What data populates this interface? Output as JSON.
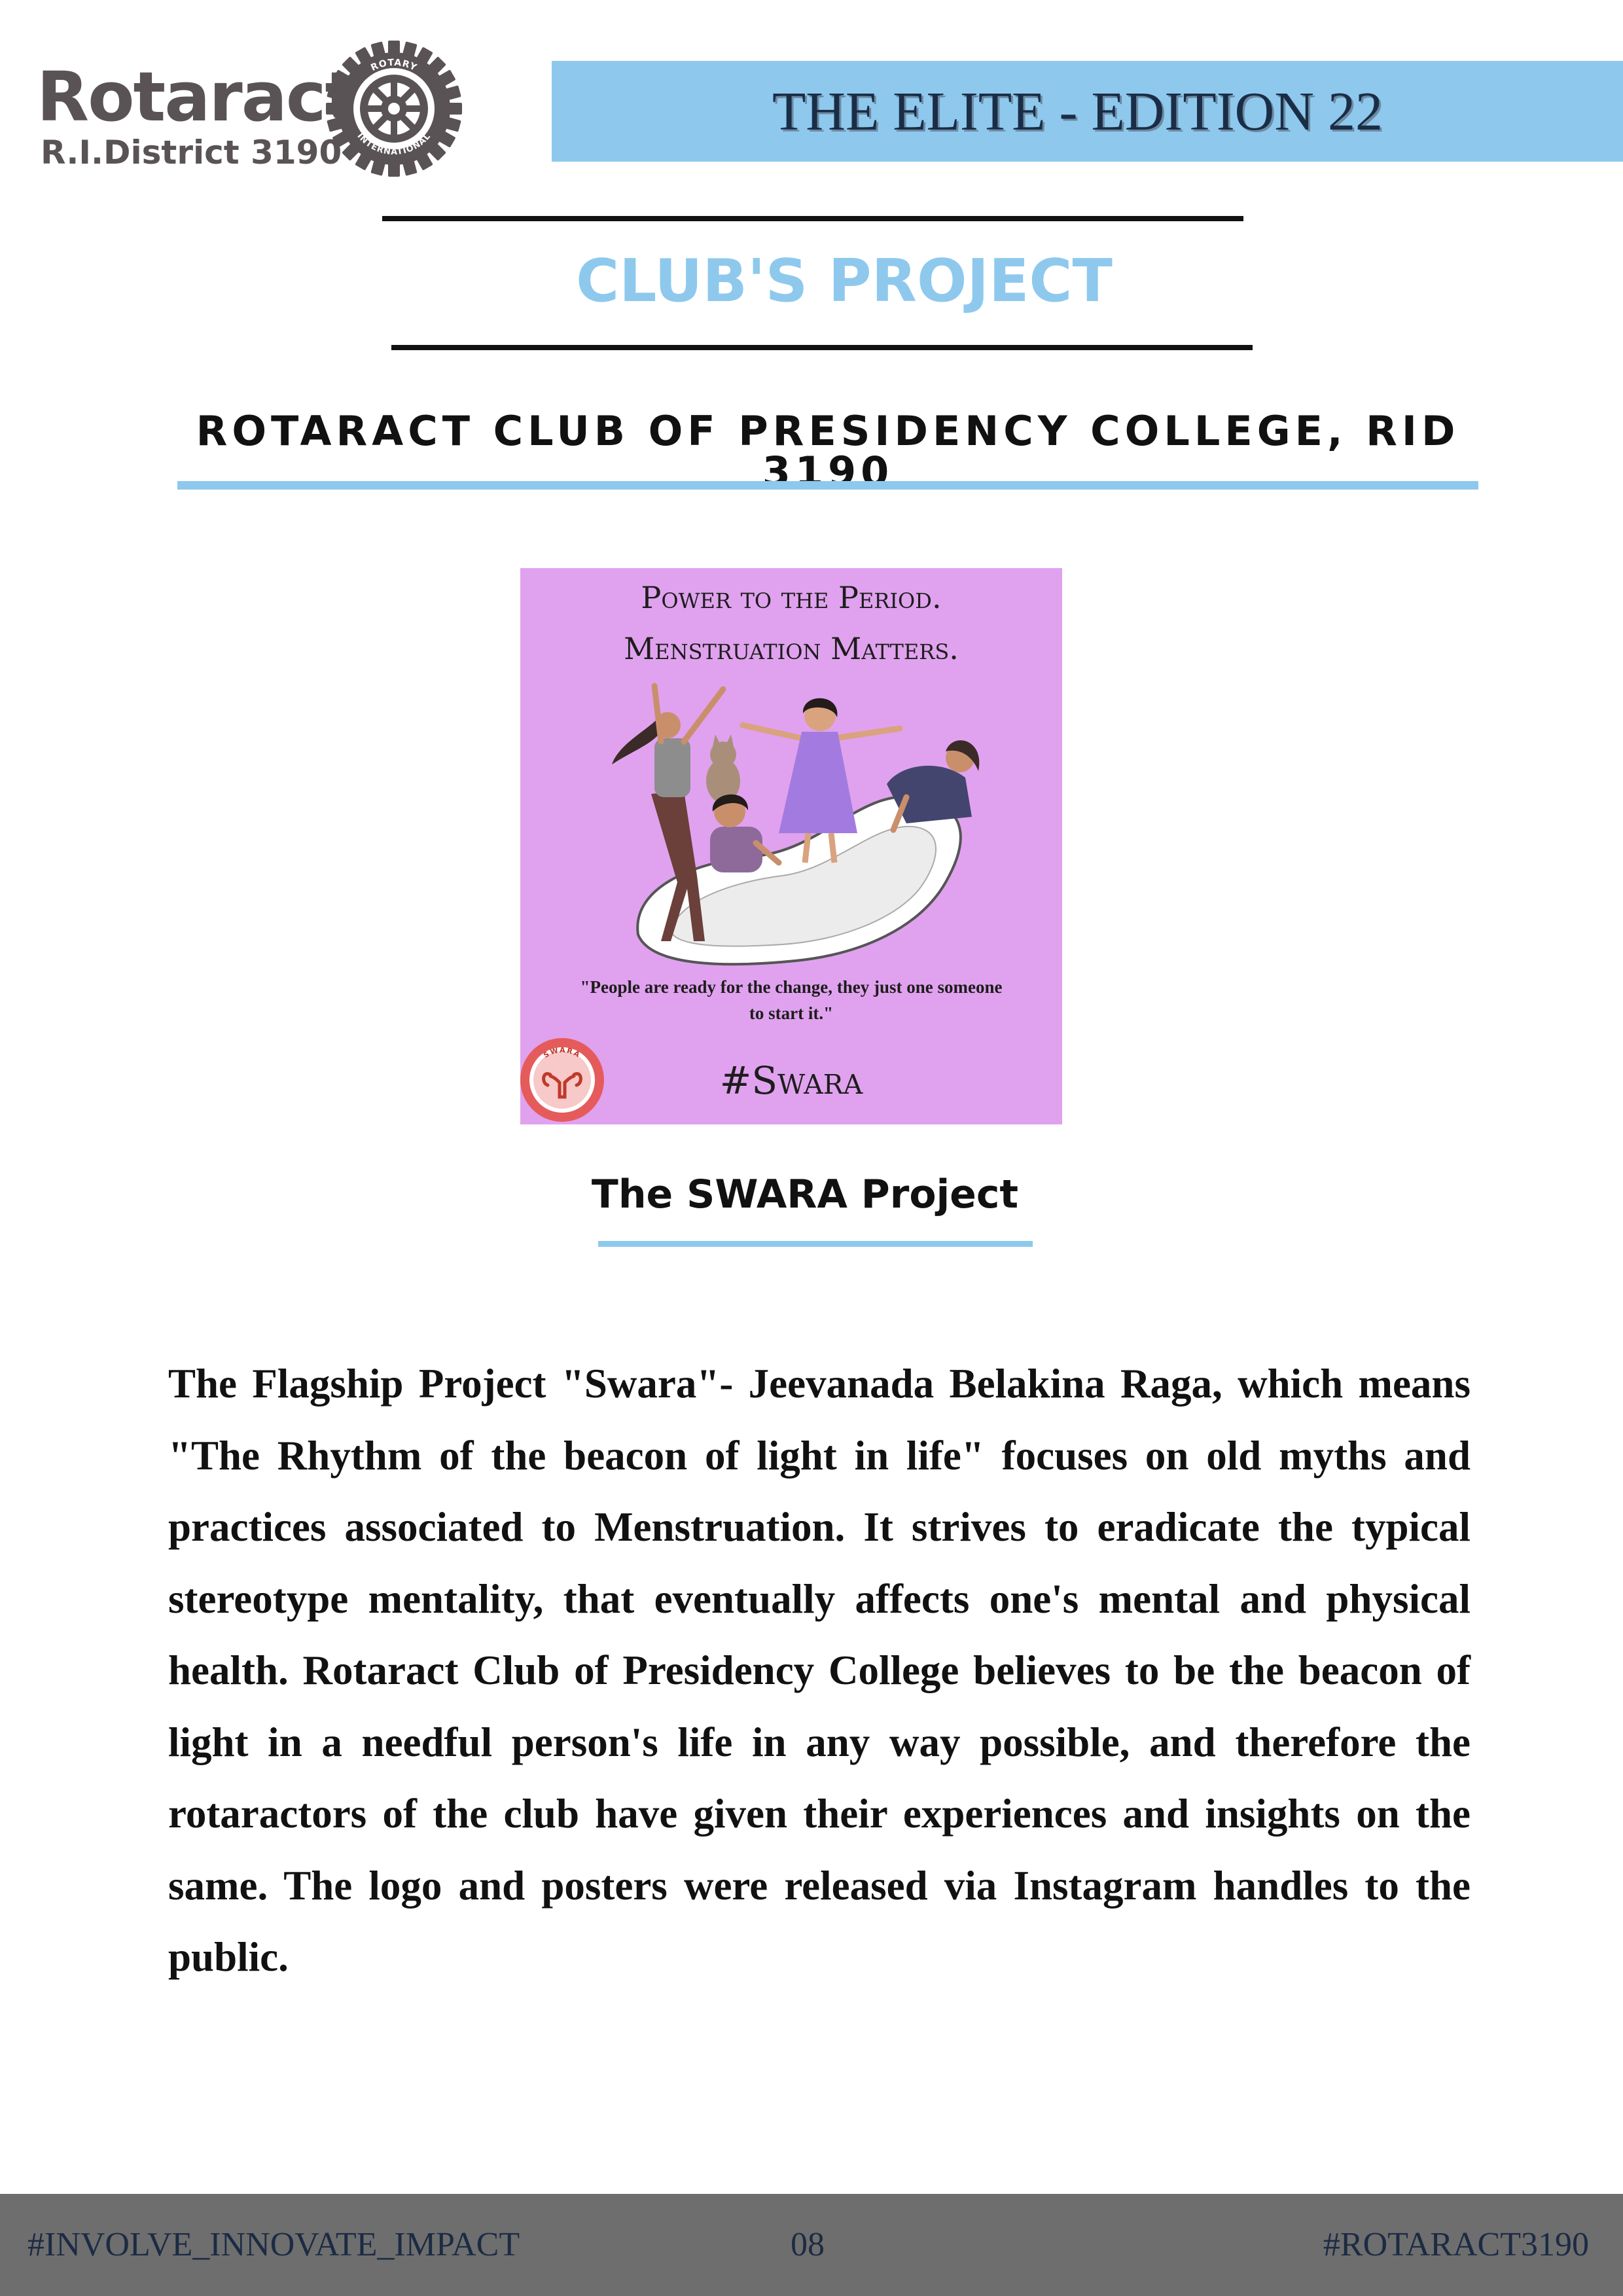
{
  "logo": {
    "wordmark": "Rotaract",
    "district": "R.I.District 3190",
    "wheel_text_top": "ROTARY",
    "wheel_text_bottom": "INTERNATIONAL"
  },
  "header": {
    "edition_title": "THE ELITE - EDITION 22"
  },
  "section": {
    "title": "CLUB'S PROJECT"
  },
  "club": {
    "name": "ROTARACT CLUB OF PRESIDENCY COLLEGE, RID 3190"
  },
  "poster": {
    "headline_1": "Power to the Period.",
    "headline_2": "Menstruation Matters.",
    "quote": "\"People are ready for the change, they just one someone to start it.\"",
    "hashtag": "#Swara",
    "badge_text": "SWARA",
    "background_color": "#e0a2ee"
  },
  "project": {
    "caption": "The SWARA Project",
    "description": "The Flagship Project \"Swara\"- Jeevanada Belakina Raga, which means \"The Rhythm of the beacon of light in life\" focuses on old myths and practices associated to Menstruation. It strives to eradicate the typical stereotype mentality, that eventually affects one's mental and physical health. Rotaract Club of Presidency College believes to be the beacon of light in a needful person's life in any way possible, and therefore the rotaractors of the club have given their experiences and insights on the same. The logo and posters were released via Instagram handles to the public."
  },
  "footer": {
    "left_hashtag": "#INVOLVE_INNOVATE_IMPACT",
    "page_number": "08",
    "right_hashtag": "#ROTARACT3190"
  },
  "colors": {
    "accent_blue": "#8ec9ed",
    "logo_gray": "#5a5356",
    "footer_gray": "#6e6e6e",
    "banner_text": "#1a2d47"
  }
}
